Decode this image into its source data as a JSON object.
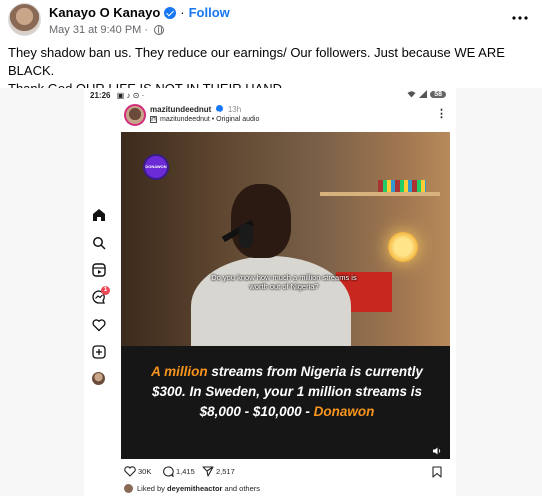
{
  "post": {
    "author": "Kanayo O Kanayo",
    "separator": "·",
    "follow_label": "Follow",
    "timestamp": "May 31 at 9:40 PM",
    "meta_separator": "·",
    "more_icon": "more-horizontal-icon",
    "caption_line1": "They shadow ban us. They reduce our earnings/ Our followers.  Just because WE ARE BLACK.",
    "caption_line2": "Thank God  OUR  LIFE IS NOT IN THEIR HAND"
  },
  "phone": {
    "time": "21:26",
    "battery": "58",
    "nav_icons": [
      "home-icon",
      "search-icon",
      "reels-icon",
      "messenger-icon",
      "heart-icon",
      "create-icon",
      "profile-avatar"
    ],
    "messenger_badge": "1"
  },
  "ig": {
    "username": "mazitundeednut",
    "time_ago": "13h",
    "audio": "mazitundeednut • Original audio",
    "badge_text": "DONAWON",
    "subtitle": "Do you know how much a million streams is worth out of Nigeria?",
    "quote_part1": "A million",
    "quote_part2": " streams from Nigeria is currently $300. In Sweden, your 1 million streams is $8,000 - $10,000 - ",
    "quote_part3": "Donawon",
    "likes": "30K",
    "comments": "1,415",
    "shares": "2,517",
    "liked_by_prefix": "Liked by ",
    "liked_by_user": "deyemitheactor",
    "liked_by_suffix": " and others"
  },
  "colors": {
    "brand_blue": "#1877f2",
    "highlight_orange": "#f7941d",
    "badge_red": "#ed4956"
  }
}
